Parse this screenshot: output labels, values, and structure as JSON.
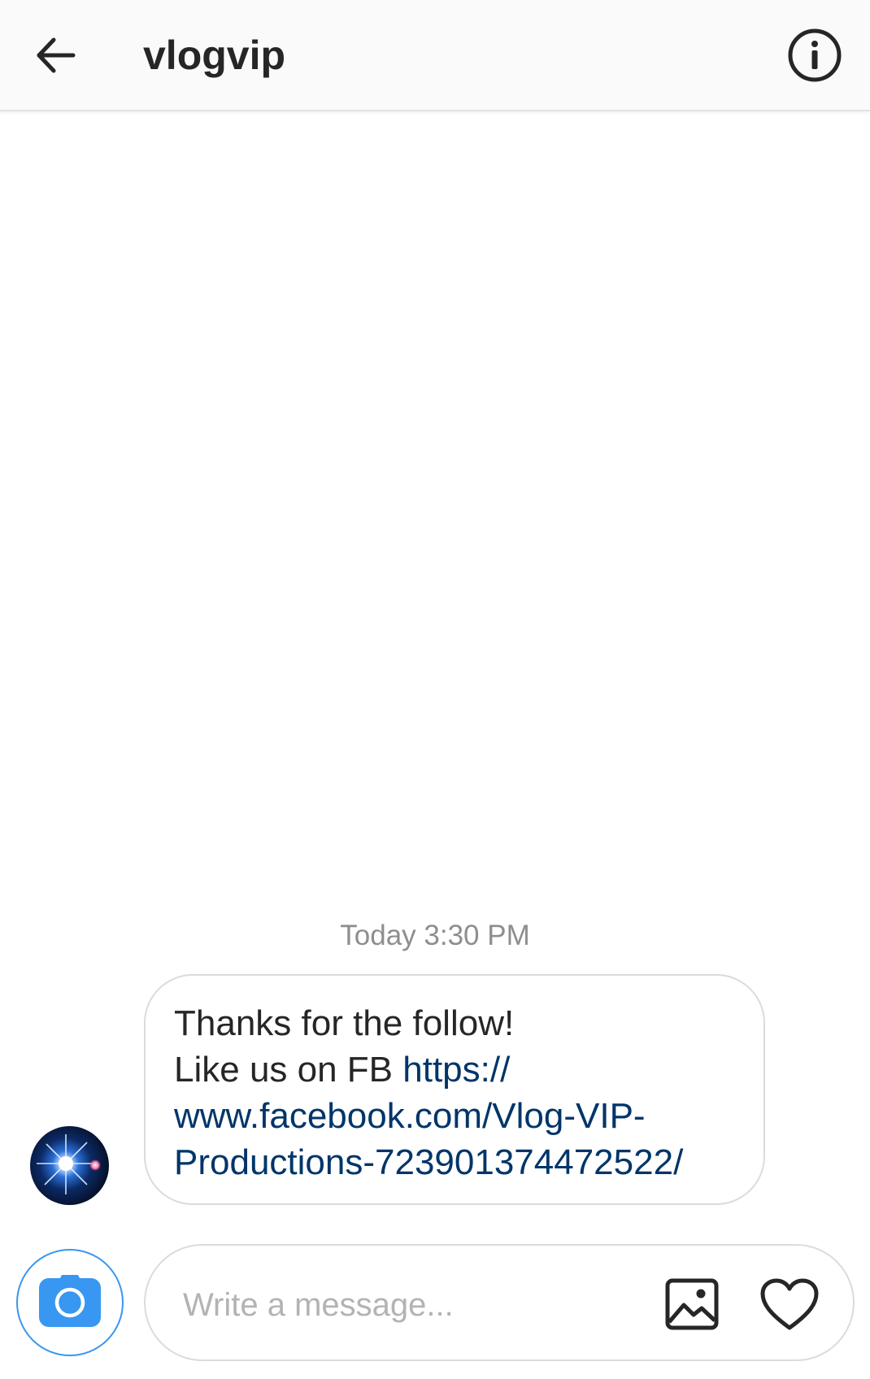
{
  "header": {
    "title": "vlogvip",
    "back_icon": "arrow-left-icon",
    "info_icon": "info-circle-icon"
  },
  "conversation": {
    "timestamp": "Today 3:30 PM",
    "messages": [
      {
        "sender_avatar": "starburst-avatar",
        "line1": "Thanks for the follow!",
        "line2_text": "Like us on FB ",
        "line2_link": "https://",
        "line3_link": "www.facebook.com/Vlog-VIP-",
        "line4_link": "Productions-723901374472522/"
      }
    ]
  },
  "composer": {
    "placeholder": "Write a message...",
    "value": "",
    "camera_icon": "camera-icon",
    "gallery_icon": "image-icon",
    "heart_icon": "heart-icon"
  },
  "colors": {
    "accent": "#3897f0",
    "link": "#003569",
    "text": "#262626",
    "muted": "#8e8e8e",
    "border": "#dbdbdb"
  }
}
